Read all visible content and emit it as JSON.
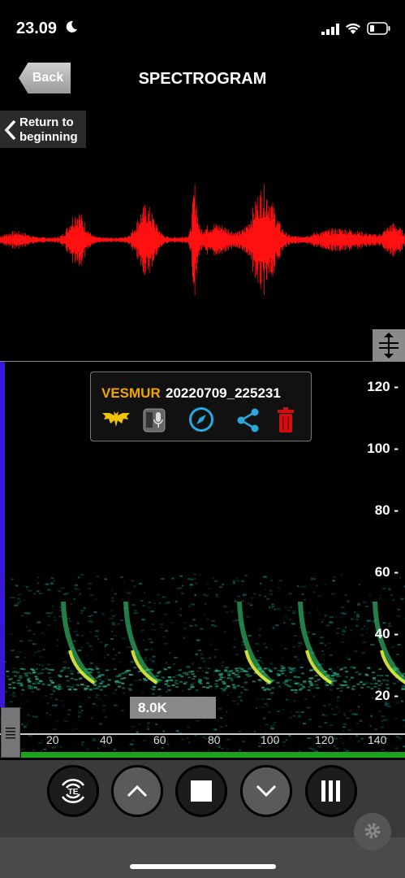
{
  "status_bar": {
    "time": "23.09",
    "moon_icon": "moon-icon",
    "signal_icon": "cellular-signal-icon",
    "wifi_icon": "wifi-icon",
    "battery_icon": "battery-icon"
  },
  "nav": {
    "back_label": "Back",
    "title": "SPECTROGRAM"
  },
  "return_button": {
    "label": "Return to\nbeginning",
    "icon": "chevron-left-icon"
  },
  "info_popup": {
    "species_code": "VESMUR",
    "recording_name": "20220709_225231",
    "icons": [
      "bat-icon",
      "recorder-icon",
      "compass-icon",
      "share-icon",
      "trash-icon"
    ]
  },
  "frequency_axis_labels": [
    "120",
    "100",
    "80",
    "60",
    "40",
    "20"
  ],
  "time_axis_labels": [
    "20",
    "40",
    "60",
    "80",
    "100",
    "120",
    "140"
  ],
  "frequency_readout": "8.0K",
  "toolbar": {
    "buttons": [
      "te-mode-button",
      "scroll-up-button",
      "stop-button",
      "scroll-down-button",
      "pause-bars-button"
    ],
    "te_label": "TE"
  },
  "colors": {
    "waveform": "#ff1010",
    "species_code": "#f0a500",
    "accent_blue": "#29a8e0",
    "trash_red": "#d01010"
  }
}
